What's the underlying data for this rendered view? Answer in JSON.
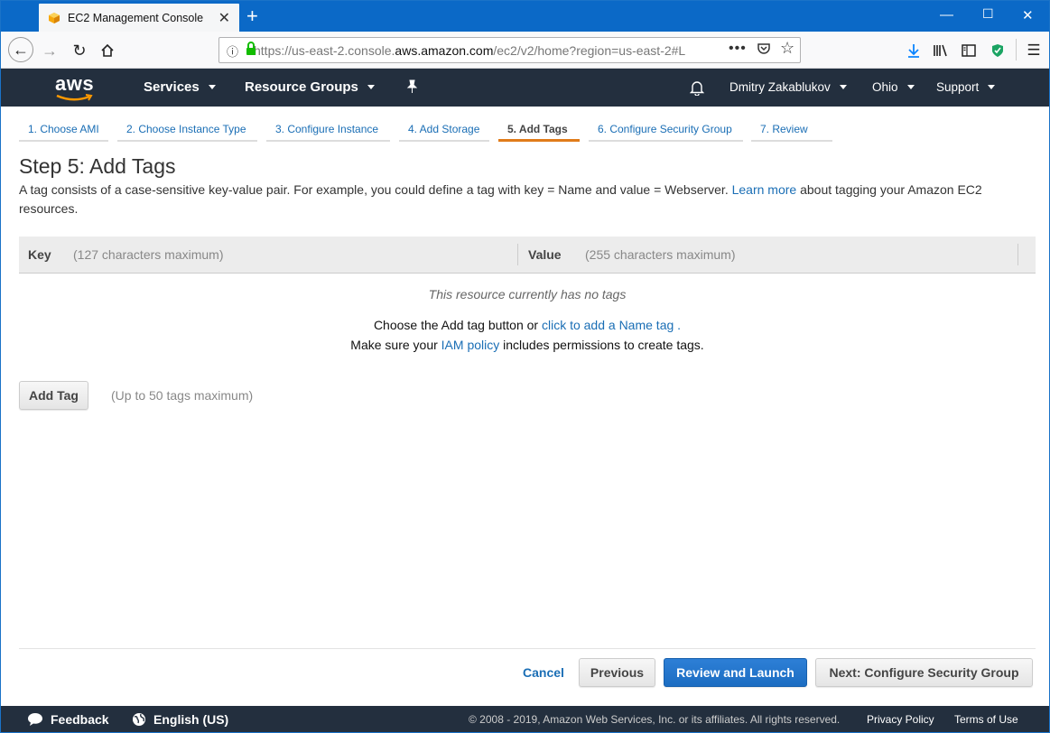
{
  "browser": {
    "tab_title": "EC2 Management Console",
    "url_prefix": "https://us-east-2.console.",
    "url_domain": "aws.amazon.com",
    "url_suffix": "/ec2/v2/home?region=us-east-2#L",
    "accent": "#0b69c7"
  },
  "aws_nav": {
    "logo": "aws",
    "services": "Services",
    "resource_groups": "Resource Groups",
    "user": "Dmitry Zakablukov",
    "region": "Ohio",
    "support": "Support",
    "bg": "#232f3e"
  },
  "wizard_steps": [
    {
      "label": "1. Choose AMI"
    },
    {
      "label": "2. Choose Instance Type"
    },
    {
      "label": "3. Configure Instance"
    },
    {
      "label": "4. Add Storage"
    },
    {
      "label": "5. Add Tags",
      "active": true
    },
    {
      "label": "6. Configure Security Group"
    },
    {
      "label": "7. Review"
    }
  ],
  "page": {
    "title": "Step 5: Add Tags",
    "desc_before": "A tag consists of a case-sensitive key-value pair. For example, you could define a tag with key = Name and value = Webserver.",
    "learn_more": "Learn more",
    "desc_after": "about tagging your Amazon EC2 resources."
  },
  "table": {
    "key_header": "Key",
    "key_hint": "(127 characters maximum)",
    "value_header": "Value",
    "value_hint": "(255 characters maximum)",
    "empty_text": "This resource currently has no tags",
    "help_line1_before": "Choose the Add tag button or",
    "help_line1_link": "click to add a Name tag",
    "help_line1_after": ".",
    "help_line2_before": "Make sure your",
    "help_line2_link": "IAM policy",
    "help_line2_after": "includes permissions to create tags."
  },
  "add_tag": {
    "label": "Add Tag",
    "hint": "(Up to 50 tags maximum)"
  },
  "actions": {
    "cancel": "Cancel",
    "previous": "Previous",
    "review_launch": "Review and Launch",
    "next": "Next: Configure Security Group"
  },
  "footer": {
    "feedback": "Feedback",
    "language": "English (US)",
    "copyright": "© 2008 - 2019, Amazon Web Services, Inc. or its affiliates. All rights reserved.",
    "privacy": "Privacy Policy",
    "terms": "Terms of Use"
  }
}
